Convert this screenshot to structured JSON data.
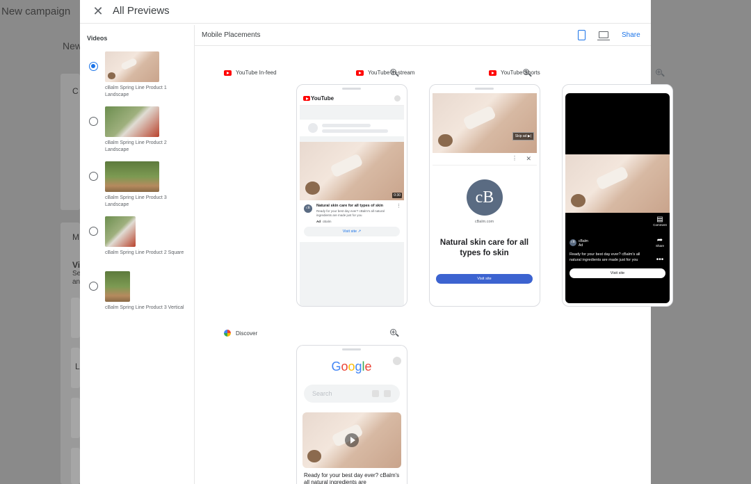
{
  "background": {
    "title": "New campaign",
    "subtitle": "New",
    "letters": [
      "C",
      "M",
      "Vi",
      "Se",
      "an",
      "L"
    ]
  },
  "modal": {
    "title": "All Previews",
    "close_icon": "close-icon"
  },
  "videos": {
    "label": "Videos",
    "items": [
      {
        "name": "cBalm Spring Line Product 1 Landscape",
        "selected": true
      },
      {
        "name": "cBalm Spring Line Product 2 Landscape",
        "selected": false
      },
      {
        "name": "cBalm Spring Line Product 3 Landscape",
        "selected": false
      },
      {
        "name": "cBalm Spring Line Product 2 Square",
        "selected": false
      },
      {
        "name": "cBalm Spring Line Product 3 Vertical",
        "selected": false
      }
    ]
  },
  "placements": {
    "title": "Mobile Placements",
    "share_label": "Share",
    "device_icons": [
      "mobile-icon",
      "desktop-icon"
    ]
  },
  "previews": {
    "in_feed": {
      "label": "YouTube In-feed",
      "logo_text": "YouTube",
      "duration": "0:30",
      "headline": "Natural skin care for all types of skin",
      "description": "Ready for your best day ever? cBalm's all natural ingredients are made just for you",
      "ad_badge": "Ad",
      "advertiser": "cBalm",
      "visit_label": "Visit site"
    },
    "in_stream": {
      "label": "YouTube In-stream",
      "skip_label": "Skip ad",
      "brand_initials": "cB",
      "brand_url": "cBalm.com",
      "headline": "Natural skin care for all types fo skin",
      "visit_label": "Visit site"
    },
    "shorts": {
      "label": "YouTube Shorts",
      "brand_name": "cBalm",
      "ad_badge": "Ad",
      "description": "Ready for your best day ever? cBalm's all natural ingredients are made just for you",
      "comment_label": "Comment",
      "share_label": "Share",
      "visit_label": "Visit site"
    },
    "discover": {
      "label": "Discover",
      "search_placeholder": "Search",
      "text": "Ready for your best day ever? cBalm's all natural ingredients are"
    }
  },
  "colors": {
    "accent": "#1a73e8",
    "youtube_red": "#ff0000",
    "brand": "#5a6b82"
  }
}
